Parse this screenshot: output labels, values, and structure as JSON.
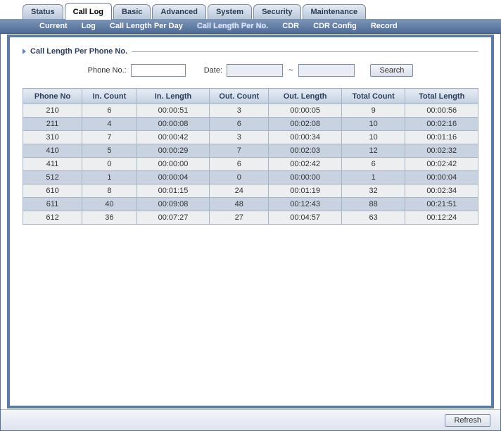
{
  "main_tabs": {
    "items": [
      {
        "label": "Status"
      },
      {
        "label": "Call Log"
      },
      {
        "label": "Basic"
      },
      {
        "label": "Advanced"
      },
      {
        "label": "System"
      },
      {
        "label": "Security"
      },
      {
        "label": "Maintenance"
      }
    ],
    "active_index": 1
  },
  "sub_tabs": {
    "items": [
      {
        "label": "Current"
      },
      {
        "label": "Log"
      },
      {
        "label": "Call Length Per Day"
      },
      {
        "label": "Call Length Per No."
      },
      {
        "label": "CDR"
      },
      {
        "label": "CDR Config"
      },
      {
        "label": "Record"
      }
    ],
    "active_index": 3
  },
  "section": {
    "title": "Call Length Per Phone No."
  },
  "search": {
    "phone_label": "Phone No.:",
    "phone_value": "",
    "date_label": "Date:",
    "date_from_value": "",
    "date_to_value": "",
    "tilde": "~",
    "button_label": "Search"
  },
  "table": {
    "headers": {
      "phone_no": "Phone No",
      "in_count": "In. Count",
      "in_length": "In. Length",
      "out_count": "Out. Count",
      "out_length": "Out. Length",
      "total_count": "Total Count",
      "total_length": "Total Length"
    },
    "rows": [
      {
        "phone_no": "210",
        "in_count": "6",
        "in_length": "00:00:51",
        "out_count": "3",
        "out_length": "00:00:05",
        "total_count": "9",
        "total_length": "00:00:56",
        "shade": "light"
      },
      {
        "phone_no": "211",
        "in_count": "4",
        "in_length": "00:00:08",
        "out_count": "6",
        "out_length": "00:02:08",
        "total_count": "10",
        "total_length": "00:02:16",
        "shade": "dark"
      },
      {
        "phone_no": "310",
        "in_count": "7",
        "in_length": "00:00:42",
        "out_count": "3",
        "out_length": "00:00:34",
        "total_count": "10",
        "total_length": "00:01:16",
        "shade": "light"
      },
      {
        "phone_no": "410",
        "in_count": "5",
        "in_length": "00:00:29",
        "out_count": "7",
        "out_length": "00:02:03",
        "total_count": "12",
        "total_length": "00:02:32",
        "shade": "dark"
      },
      {
        "phone_no": "411",
        "in_count": "0",
        "in_length": "00:00:00",
        "out_count": "6",
        "out_length": "00:02:42",
        "total_count": "6",
        "total_length": "00:02:42",
        "shade": "light"
      },
      {
        "phone_no": "512",
        "in_count": "1",
        "in_length": "00:00:04",
        "out_count": "0",
        "out_length": "00:00:00",
        "total_count": "1",
        "total_length": "00:00:04",
        "shade": "dark"
      },
      {
        "phone_no": "610",
        "in_count": "8",
        "in_length": "00:01:15",
        "out_count": "24",
        "out_length": "00:01:19",
        "total_count": "32",
        "total_length": "00:02:34",
        "shade": "light"
      },
      {
        "phone_no": "611",
        "in_count": "40",
        "in_length": "00:09:08",
        "out_count": "48",
        "out_length": "00:12:43",
        "total_count": "88",
        "total_length": "00:21:51",
        "shade": "dark"
      },
      {
        "phone_no": "612",
        "in_count": "36",
        "in_length": "00:07:27",
        "out_count": "27",
        "out_length": "00:04:57",
        "total_count": "63",
        "total_length": "00:12:24",
        "shade": "light"
      }
    ]
  },
  "footer": {
    "refresh_label": "Refresh"
  }
}
